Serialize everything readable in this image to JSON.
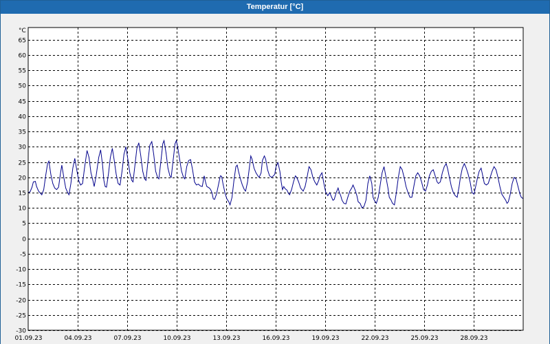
{
  "window": {
    "title": "Temperatur [°C]"
  },
  "chart_data": {
    "type": "line",
    "title": "Temperatur [°C]",
    "unit_label": "°C",
    "xlabel": "",
    "ylabel": "",
    "ylim": [
      -30,
      69
    ],
    "xlim": [
      0,
      30
    ],
    "yticks": [
      65,
      60,
      55,
      50,
      45,
      40,
      35,
      30,
      25,
      20,
      15,
      10,
      5,
      0,
      -5,
      -10,
      -15,
      -20,
      -25,
      -30
    ],
    "xticks": [
      {
        "value": 0,
        "label": "01.09.23"
      },
      {
        "value": 3,
        "label": "04.09.23"
      },
      {
        "value": 6,
        "label": "07.09.23"
      },
      {
        "value": 9,
        "label": "10.09.23"
      },
      {
        "value": 12,
        "label": "13.09.23"
      },
      {
        "value": 15,
        "label": "16.09.23"
      },
      {
        "value": 18,
        "label": "19.09.23"
      },
      {
        "value": 21,
        "label": "22.09.23"
      },
      {
        "value": 24,
        "label": "25.09.23"
      },
      {
        "value": 27,
        "label": "28.09.23"
      }
    ],
    "grid": true,
    "line_color": "#00008b",
    "x_unit": "days since 01.09.23 00:00",
    "series": [
      {
        "name": "",
        "values": [
          [
            0.0,
            15.0
          ],
          [
            0.15,
            15.3
          ],
          [
            0.3,
            16.8
          ],
          [
            0.4,
            18.5
          ],
          [
            0.55,
            18.7
          ],
          [
            0.65,
            17.0
          ],
          [
            0.8,
            15.5
          ],
          [
            0.95,
            14.8
          ],
          [
            1.05,
            14.3
          ],
          [
            1.2,
            16.0
          ],
          [
            1.35,
            20.5
          ],
          [
            1.5,
            24.5
          ],
          [
            1.6,
            25.3
          ],
          [
            1.75,
            21.0
          ],
          [
            1.9,
            18.0
          ],
          [
            2.05,
            16.5
          ],
          [
            2.2,
            16.0
          ],
          [
            2.35,
            16.8
          ],
          [
            2.5,
            21.5
          ],
          [
            2.6,
            24.0
          ],
          [
            2.75,
            20.0
          ],
          [
            2.9,
            16.5
          ],
          [
            3.05,
            15.0
          ],
          [
            3.15,
            14.3
          ],
          [
            3.3,
            18.0
          ],
          [
            3.45,
            23.0
          ],
          [
            3.6,
            26.2
          ],
          [
            3.75,
            22.5
          ],
          [
            3.9,
            19.0
          ],
          [
            4.05,
            17.5
          ],
          [
            4.2,
            18.0
          ],
          [
            4.35,
            23.0
          ],
          [
            4.55,
            28.8
          ],
          [
            4.7,
            26.5
          ],
          [
            4.85,
            21.5
          ],
          [
            5.0,
            19.0
          ],
          [
            5.1,
            17.0
          ],
          [
            5.25,
            20.5
          ],
          [
            5.45,
            26.5
          ],
          [
            5.6,
            29.0
          ],
          [
            5.75,
            24.0
          ],
          [
            5.85,
            19.0
          ],
          [
            5.95,
            17.0
          ],
          [
            6.05,
            16.8
          ],
          [
            6.2,
            21.0
          ],
          [
            6.35,
            26.5
          ],
          [
            6.5,
            29.5
          ],
          [
            6.65,
            25.5
          ],
          [
            6.8,
            21.0
          ],
          [
            6.95,
            18.0
          ],
          [
            7.1,
            17.5
          ],
          [
            7.25,
            22.0
          ],
          [
            7.4,
            27.5
          ],
          [
            7.55,
            30.0
          ],
          [
            7.7,
            26.0
          ],
          [
            7.85,
            21.5
          ],
          [
            8.0,
            19.0
          ],
          [
            8.1,
            18.5
          ],
          [
            8.25,
            24.0
          ],
          [
            8.4,
            29.5
          ],
          [
            8.55,
            31.3
          ],
          [
            8.7,
            27.0
          ],
          [
            8.85,
            22.0
          ],
          [
            9.0,
            19.5
          ],
          [
            9.1,
            19.0
          ],
          [
            9.25,
            25.0
          ],
          [
            9.4,
            30.5
          ],
          [
            9.55,
            31.7
          ],
          [
            9.7,
            27.5
          ],
          [
            9.85,
            22.0
          ],
          [
            10.0,
            20.0
          ],
          [
            10.1,
            19.5
          ],
          [
            10.25,
            25.0
          ],
          [
            10.4,
            31.0
          ],
          [
            10.5,
            32.0
          ],
          [
            10.65,
            28.0
          ],
          [
            10.8,
            23.0
          ],
          [
            10.95,
            20.5
          ],
          [
            11.05,
            20.0
          ],
          [
            11.2,
            25.5
          ],
          [
            11.35,
            31.0
          ],
          [
            11.45,
            32.0
          ],
          [
            11.55,
            30.0
          ],
          [
            11.7,
            26.0
          ],
          [
            11.85,
            22.0
          ],
          [
            12.0,
            20.0
          ],
          [
            12.1,
            19.5
          ],
          [
            12.25,
            23.5
          ],
          [
            12.4,
            25.5
          ],
          [
            12.55,
            25.8
          ],
          [
            12.7,
            22.5
          ],
          [
            12.85,
            18.5
          ],
          [
            13.0,
            17.5
          ],
          [
            13.15,
            17.8
          ],
          [
            13.3,
            17.2
          ],
          [
            13.45,
            17.0
          ],
          [
            13.6,
            20.5
          ],
          [
            13.7,
            18.5
          ],
          [
            13.8,
            17.0
          ],
          [
            14.0,
            16.5
          ],
          [
            14.1,
            16.0
          ],
          [
            14.2,
            15.0
          ],
          [
            14.3,
            13.0
          ],
          [
            14.4,
            12.8
          ],
          [
            14.55,
            14.5
          ],
          [
            14.7,
            17.5
          ],
          [
            14.85,
            20.5
          ],
          [
            14.95,
            20.3
          ],
          [
            15.05,
            18.0
          ],
          [
            15.2,
            15.0
          ],
          [
            15.35,
            13.0
          ],
          [
            15.5,
            12.0
          ],
          [
            15.6,
            11.0
          ],
          [
            15.75,
            13.5
          ],
          [
            15.9,
            19.0
          ],
          [
            16.05,
            23.5
          ],
          [
            16.15,
            24.0
          ],
          [
            16.25,
            22.0
          ],
          [
            16.4,
            19.5
          ],
          [
            16.55,
            17.5
          ],
          [
            16.7,
            16.0
          ],
          [
            16.8,
            15.5
          ],
          [
            16.95,
            18.5
          ],
          [
            17.1,
            23.5
          ],
          [
            17.2,
            27.0
          ],
          [
            17.3,
            26.0
          ],
          [
            17.45,
            23.0
          ],
          [
            17.6,
            21.5
          ],
          [
            17.75,
            20.5
          ],
          [
            17.85,
            20.0
          ],
          [
            18.0,
            21.5
          ],
          [
            18.1,
            25.5
          ],
          [
            18.25,
            27.0
          ],
          [
            18.35,
            26.0
          ],
          [
            18.5,
            22.5
          ],
          [
            18.65,
            20.5
          ],
          [
            18.8,
            20.0
          ],
          [
            18.95,
            20.5
          ],
          [
            19.05,
            21.0
          ],
          [
            19.15,
            23.5
          ],
          [
            19.3,
            24.8
          ],
          [
            19.45,
            22.0
          ],
          [
            19.55,
            18.5
          ],
          [
            19.65,
            16.0
          ],
          [
            19.75,
            17.0
          ],
          [
            19.85,
            16.3
          ],
          [
            20.0,
            15.8
          ],
          [
            20.1,
            14.8
          ],
          [
            20.2,
            14.3
          ],
          [
            20.35,
            16.0
          ],
          [
            20.5,
            18.5
          ],
          [
            20.65,
            20.5
          ],
          [
            20.75,
            20.0
          ],
          [
            20.9,
            18.5
          ],
          [
            21.05,
            16.5
          ],
          [
            21.15,
            16.0
          ],
          [
            21.25,
            15.5
          ],
          [
            21.4,
            17.0
          ],
          [
            21.55,
            20.0
          ],
          [
            21.7,
            23.5
          ],
          [
            21.85,
            22.5
          ],
          [
            22.0,
            20.0
          ],
          [
            22.15,
            18.5
          ],
          [
            22.3,
            17.5
          ],
          [
            22.45,
            19.0
          ],
          [
            22.55,
            20.5
          ],
          [
            22.7,
            21.5
          ],
          [
            22.85,
            18.0
          ],
          [
            23.0,
            15.0
          ],
          [
            23.15,
            14.0
          ],
          [
            23.3,
            15.0
          ],
          [
            23.45,
            13.5
          ],
          [
            23.55,
            12.5
          ],
          [
            23.65,
            12.8
          ],
          [
            23.8,
            15.0
          ],
          [
            23.95,
            16.5
          ],
          [
            24.05,
            15.0
          ],
          [
            24.15,
            14.0
          ],
          [
            24.25,
            12.5
          ],
          [
            24.4,
            11.5
          ],
          [
            24.55,
            11.3
          ],
          [
            24.7,
            13.5
          ],
          [
            24.85,
            15.5
          ],
          [
            25.0,
            16.5
          ],
          [
            25.1,
            17.5
          ],
          [
            25.25,
            16.0
          ],
          [
            25.4,
            14.0
          ],
          [
            25.5,
            12.0
          ],
          [
            25.65,
            11.5
          ],
          [
            25.8,
            10.0
          ],
          [
            25.95,
            10.5
          ],
          [
            26.1,
            12.5
          ],
          [
            26.25,
            18.0
          ],
          [
            26.4,
            20.5
          ],
          [
            26.55,
            18.0
          ],
          [
            26.65,
            13.5
          ],
          [
            26.75,
            12.5
          ],
          [
            26.9,
            11.5
          ],
          [
            27.05,
            13.5
          ],
          [
            27.2,
            17.5
          ],
          [
            27.35,
            21.5
          ],
          [
            27.5,
            23.5
          ],
          [
            27.65,
            20.0
          ],
          [
            27.8,
            16.5
          ],
          [
            27.9,
            13.5
          ],
          [
            28.05,
            12.5
          ],
          [
            28.15,
            11.5
          ],
          [
            28.3,
            11.0
          ],
          [
            28.45,
            15.0
          ],
          [
            28.6,
            20.0
          ],
          [
            28.75,
            23.5
          ],
          [
            28.9,
            22.5
          ],
          [
            29.05,
            20.0
          ],
          [
            29.2,
            17.0
          ],
          [
            29.35,
            15.0
          ],
          [
            29.5,
            13.5
          ],
          [
            29.65,
            13.5
          ],
          [
            29.8,
            17.0
          ],
          [
            29.95,
            20.5
          ],
          [
            30.1,
            21.5
          ],
          [
            30.25,
            20.5
          ],
          [
            30.4,
            18.5
          ],
          [
            30.55,
            16.0
          ],
          [
            30.7,
            15.5
          ],
          [
            30.85,
            17.5
          ],
          [
            31.0,
            20.5
          ],
          [
            31.15,
            22.0
          ],
          [
            31.3,
            22.5
          ],
          [
            31.45,
            20.5
          ],
          [
            31.6,
            18.5
          ],
          [
            31.7,
            18.0
          ],
          [
            31.85,
            18.5
          ],
          [
            32.0,
            21.5
          ],
          [
            32.15,
            23.5
          ],
          [
            32.3,
            24.5
          ],
          [
            32.4,
            23.0
          ],
          [
            32.55,
            20.0
          ],
          [
            32.7,
            17.0
          ],
          [
            32.85,
            15.0
          ],
          [
            33.0,
            14.0
          ],
          [
            33.15,
            13.5
          ],
          [
            33.3,
            17.0
          ],
          [
            33.4,
            20.0
          ],
          [
            33.55,
            23.0
          ],
          [
            33.7,
            24.5
          ],
          [
            33.85,
            23.0
          ],
          [
            34.0,
            21.0
          ],
          [
            34.15,
            18.5
          ],
          [
            34.3,
            15.0
          ],
          [
            34.45,
            14.5
          ],
          [
            34.55,
            16.5
          ],
          [
            34.7,
            19.5
          ],
          [
            34.85,
            22.0
          ],
          [
            35.0,
            23.0
          ],
          [
            35.1,
            21.0
          ],
          [
            35.25,
            18.0
          ],
          [
            35.4,
            17.5
          ],
          [
            35.55,
            18.0
          ],
          [
            35.7,
            20.0
          ],
          [
            35.85,
            22.0
          ],
          [
            36.0,
            23.5
          ],
          [
            36.15,
            22.5
          ],
          [
            36.3,
            20.0
          ],
          [
            36.45,
            17.0
          ],
          [
            36.6,
            14.5
          ],
          [
            36.75,
            13.5
          ],
          [
            36.9,
            12.5
          ],
          [
            37.0,
            11.5
          ],
          [
            37.1,
            12.0
          ],
          [
            37.25,
            14.5
          ],
          [
            37.4,
            18.0
          ],
          [
            37.55,
            20.0
          ],
          [
            37.7,
            19.5
          ],
          [
            37.85,
            17.0
          ],
          [
            38.0,
            14.5
          ],
          [
            38.1,
            13.5
          ],
          [
            38.25,
            13.0
          ]
        ]
      }
    ]
  }
}
